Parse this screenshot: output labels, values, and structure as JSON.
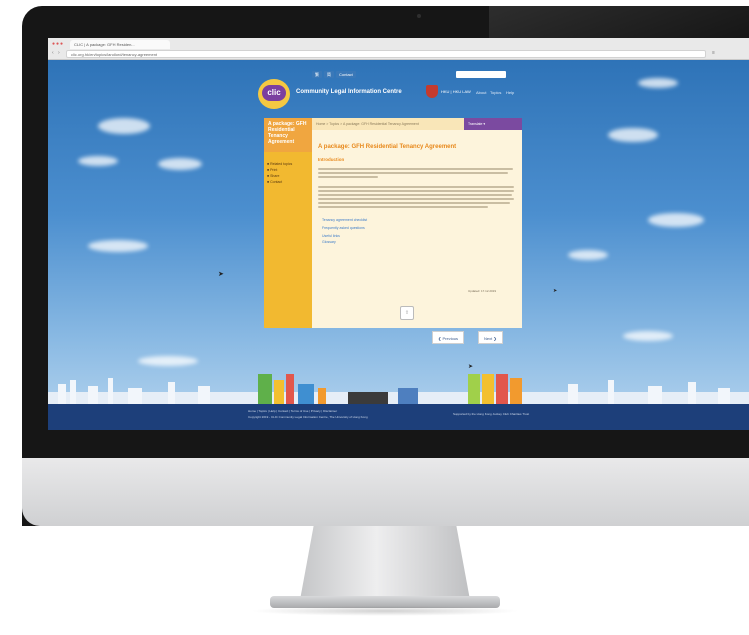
{
  "browser": {
    "tab_title": "CLIC | A package: GFH Residen...",
    "url": "clic.org.hk/en/topics/landlord/tenancy-agreement"
  },
  "site": {
    "logo_text": "clic",
    "title": "Community Legal Information Centre",
    "university": "HKU | HKU LAW",
    "topnav": [
      "繁",
      "简",
      "Contact"
    ],
    "header_links": [
      "About",
      "Topics",
      "Help"
    ]
  },
  "sidebar": {
    "heading": "A package: GFH Residential Tenancy Agreement",
    "items": [
      "Related topics",
      "Print",
      "Share",
      "Contact"
    ]
  },
  "content": {
    "breadcrumb": "Home > Topics > A package: GFH Residential Tenancy Agreement",
    "translate_label": "Translate ▾",
    "title": "A package: GFH Residential Tenancy Agreement",
    "subtitle": "Introduction",
    "links": [
      "Tenancy agreement checklist",
      "Frequently asked questions",
      "Useful links",
      "Glossary"
    ],
    "updated": "Updated: 17.12.2019"
  },
  "pager": {
    "previous": "❮ Previous",
    "next": "Next ❯"
  },
  "footer": {
    "links": "Home | Topics | Help | Contact | Terms of Use | Privacy | Disclaimer",
    "copyright": "Copyright 2019 - CLIC Community Legal Information Centre, The University of Hong Kong",
    "right_note": "Supported by the Hong Kong Jockey Club Charities Trust"
  },
  "colors": {
    "sky": "#4c8fcf",
    "sidebar": "#f2b930",
    "accent": "#e8891c",
    "footer": "#1d3f7a",
    "brand_purple": "#7b4aa0"
  }
}
